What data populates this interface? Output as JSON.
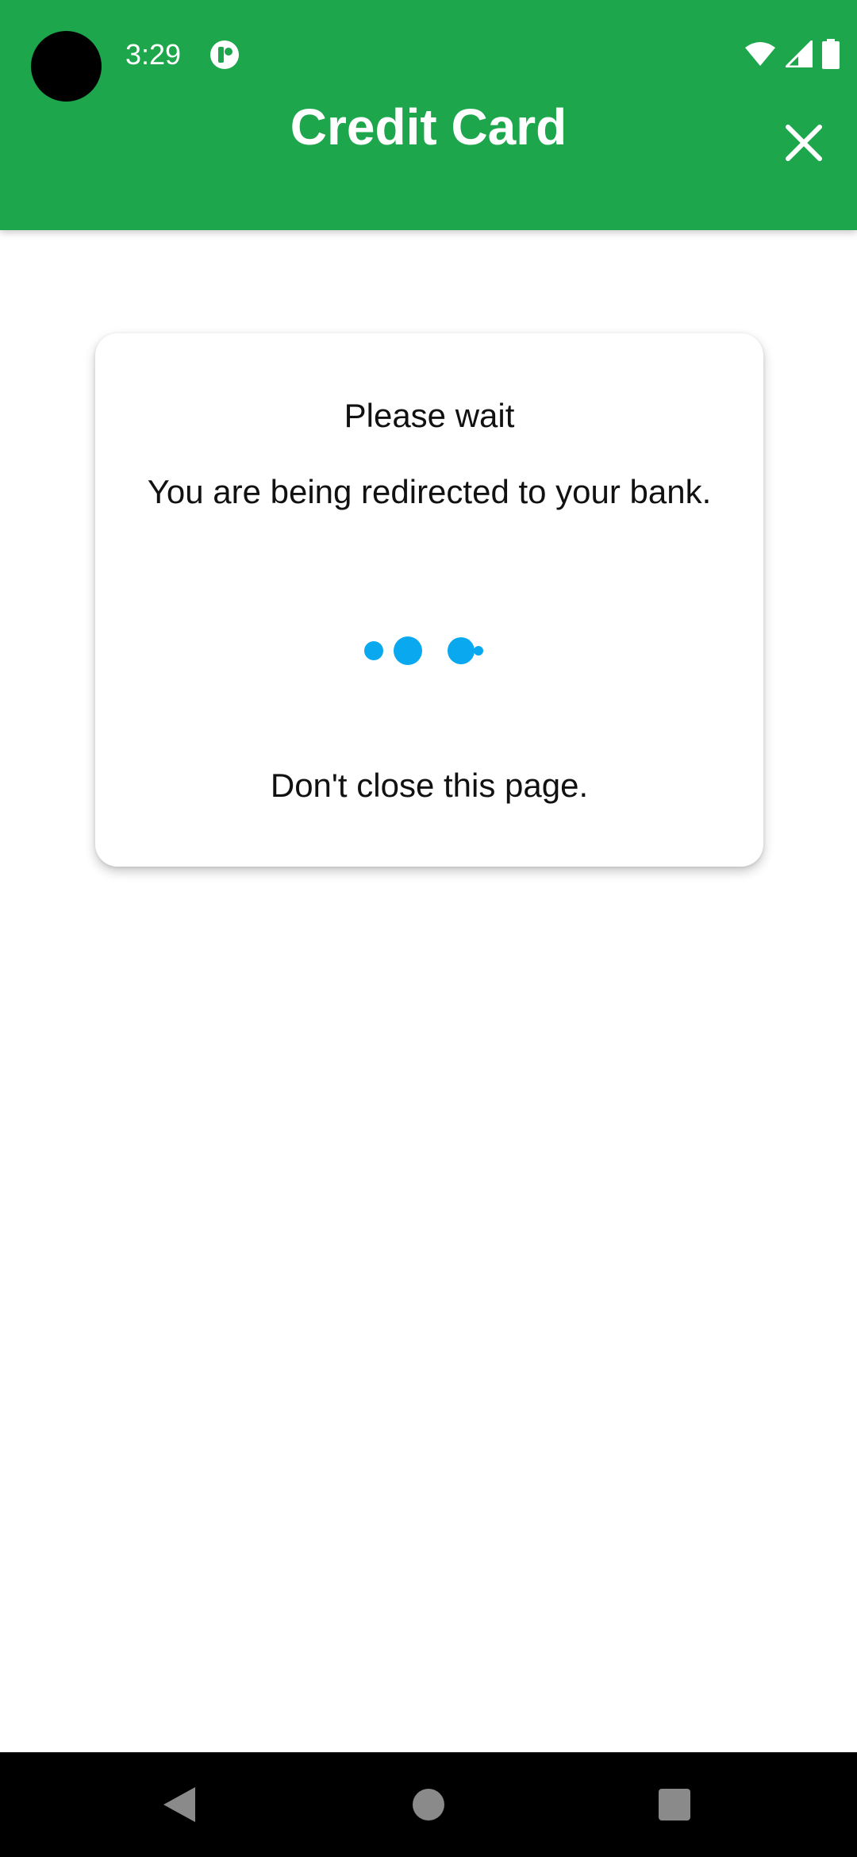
{
  "status_bar": {
    "time": "3:29",
    "icons": [
      "notification-app-icon",
      "wifi-icon",
      "cell-signal-icon",
      "battery-icon"
    ]
  },
  "app_bar": {
    "title": "Credit Card",
    "close_icon": "close-icon",
    "background_color": "#1ea64c"
  },
  "card": {
    "heading": "Please wait",
    "message": "You are being redirected to your bank.",
    "loader_icon": "loading-dots-icon",
    "loader_color": "#0aa8ef",
    "warning": "Don't close this page."
  },
  "nav_bar": {
    "buttons": [
      "back-icon",
      "home-icon",
      "recents-icon"
    ]
  }
}
